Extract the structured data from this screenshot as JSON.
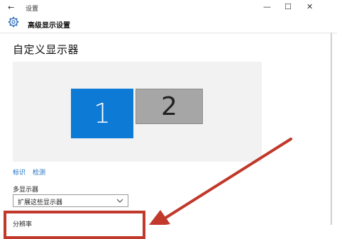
{
  "window": {
    "back_glyph": "←",
    "title": "设置",
    "controls": {
      "minimize": "—",
      "maximize": "☐",
      "close": "✕"
    }
  },
  "header": {
    "icon": "gear-icon",
    "title": "高级显示设置"
  },
  "main": {
    "section_title": "自定义显示器",
    "monitors": [
      {
        "label": "1",
        "selected": true
      },
      {
        "label": "2",
        "selected": false
      }
    ],
    "links": {
      "identify": "标识",
      "detect": "检测"
    },
    "multi_display": {
      "label": "多显示器",
      "selected": "扩展这些显示器"
    },
    "resolution_label": "分辨率"
  },
  "annotation": {
    "color": "#c0392b"
  },
  "colors": {
    "accent": "#0d7ad6",
    "link": "#1a6fc0"
  }
}
